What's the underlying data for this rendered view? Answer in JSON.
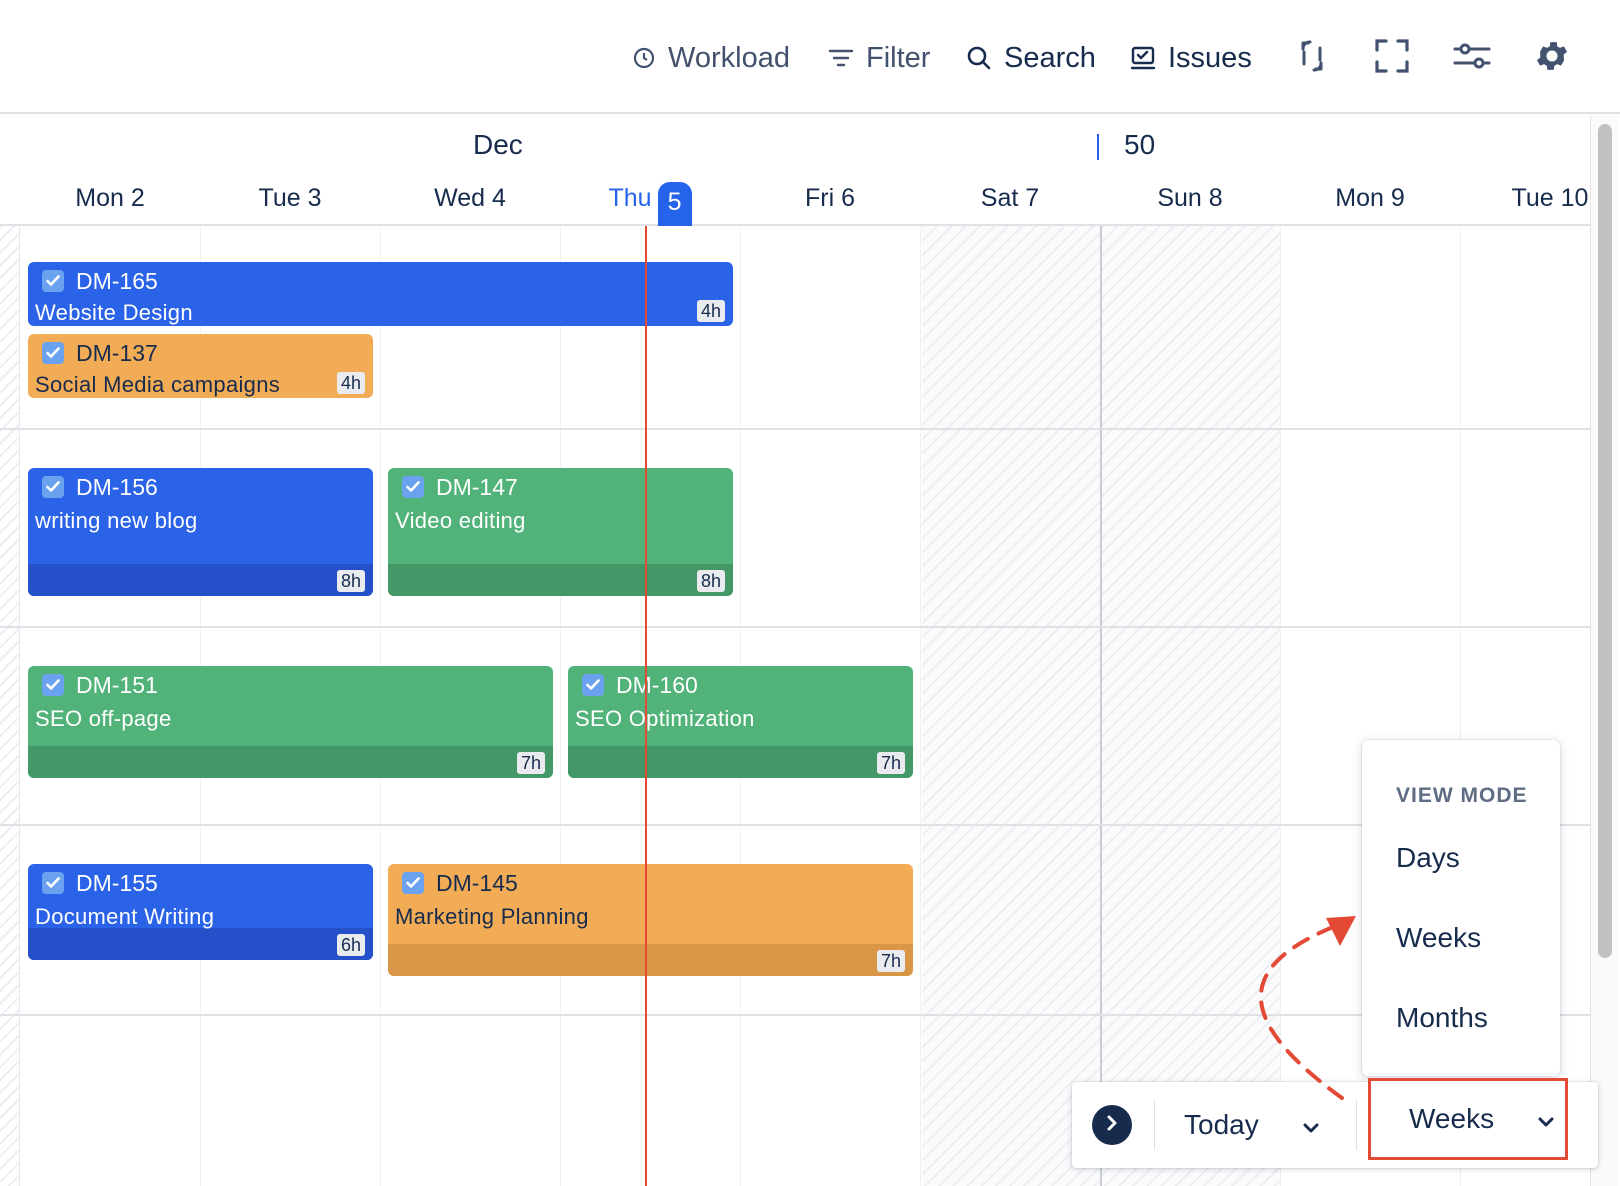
{
  "toolbar": {
    "workload_label": "Workload",
    "filter_label": "Filter",
    "search_label": "Search",
    "issues_label": "Issues"
  },
  "calendar": {
    "month": "Dec",
    "week_number": "50",
    "days": [
      {
        "name": "Mon",
        "num": "2"
      },
      {
        "name": "Tue",
        "num": "3"
      },
      {
        "name": "Wed",
        "num": "4"
      },
      {
        "name": "Thu",
        "num": "5"
      },
      {
        "name": "Fri",
        "num": "6"
      },
      {
        "name": "Sat",
        "num": "7"
      },
      {
        "name": "Sun",
        "num": "8"
      },
      {
        "name": "Mon",
        "num": "9"
      },
      {
        "name": "Tue",
        "num": "10"
      }
    ],
    "today_index": 3
  },
  "tasks": [
    {
      "key": "DM-165",
      "title": "Website Design",
      "hours": "4h",
      "color": "#2a62e8"
    },
    {
      "key": "DM-137",
      "title": "Social Media campaigns",
      "hours": "4h",
      "color": "#f2ac56"
    },
    {
      "key": "DM-156",
      "title": "writing new blog",
      "hours": "8h",
      "color": "#2a62e8"
    },
    {
      "key": "DM-147",
      "title": "Video editing",
      "hours": "8h",
      "color": "#52b37a"
    },
    {
      "key": "DM-151",
      "title": "SEO off-page",
      "hours": "7h",
      "color": "#52b37a"
    },
    {
      "key": "DM-160",
      "title": "SEO Optimization",
      "hours": "7h",
      "color": "#52b37a"
    },
    {
      "key": "DM-155",
      "title": "Document Writing",
      "hours": "6h",
      "color": "#2a62e8"
    },
    {
      "key": "DM-145",
      "title": "Marketing Planning",
      "hours": "7h",
      "color": "#f2ac56"
    }
  ],
  "view_menu": {
    "heading": "VIEW MODE",
    "options": [
      "Days",
      "Weeks",
      "Months"
    ]
  },
  "bottom_bar": {
    "today_label": "Today",
    "view_selected": "Weeks"
  },
  "colors": {
    "accent": "#2563eb",
    "today_line": "#e34935",
    "highlight": "#e34935"
  }
}
